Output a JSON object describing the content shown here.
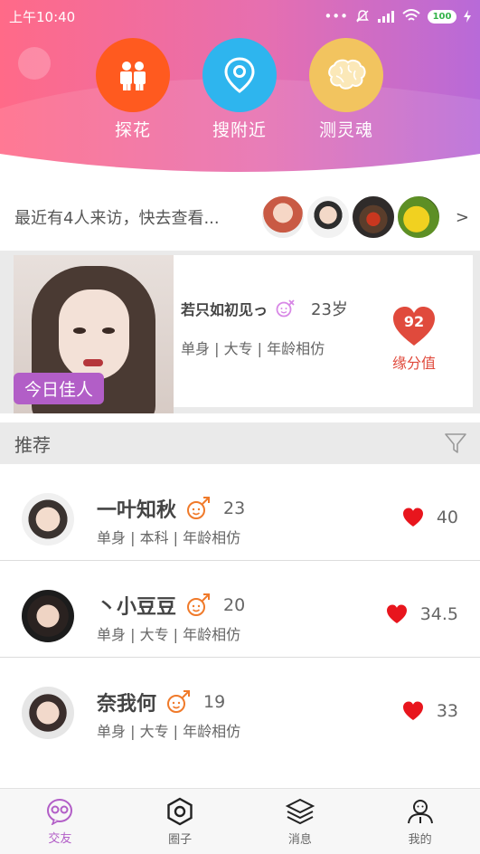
{
  "status_bar": {
    "time": "上午10:40",
    "dots": "•••",
    "battery": "100"
  },
  "features": [
    {
      "label": "探花",
      "icon": "people-icon",
      "color": "#ff5a1f"
    },
    {
      "label": "搜附近",
      "icon": "location-pin-icon",
      "color": "#2eb5ee"
    },
    {
      "label": "测灵魂",
      "icon": "brain-icon",
      "color": "#f2c45f"
    }
  ],
  "visitors": {
    "text": "最近有4人来访，快去查看...",
    "more": ">"
  },
  "today_pick": {
    "badge": "今日佳人",
    "name": "若只如初见っ",
    "age": "23岁",
    "tags": "单身 | 大专 | 年龄相仿",
    "score": "92",
    "score_label": "缘分值",
    "gender_icon": "female-gender-icon"
  },
  "recommend": {
    "title": "推荐",
    "filter_icon": "filter-icon"
  },
  "list": [
    {
      "name": "一叶知秋",
      "age": "23",
      "tags": "单身 | 本科 | 年龄相仿",
      "score": "40"
    },
    {
      "name": "丶小豆豆",
      "age": "20",
      "tags": "单身 | 大专 | 年龄相仿",
      "score": "34.5"
    },
    {
      "name": "奈我何",
      "age": "19",
      "tags": "单身 | 大专 | 年龄相仿",
      "score": "33"
    }
  ],
  "tabs": [
    {
      "label": "交友",
      "icon": "friends-icon",
      "active": true
    },
    {
      "label": "圈子",
      "icon": "hexagon-icon",
      "active": false
    },
    {
      "label": "消息",
      "icon": "layers-icon",
      "active": false
    },
    {
      "label": "我的",
      "icon": "profile-icon",
      "active": false
    }
  ],
  "colors": {
    "header_gradient_start": "#ff6a88",
    "header_gradient_end": "#b86ad8",
    "accent": "#b25ec7",
    "heart": "#e8151d",
    "gender_male": "#f07a2a",
    "gender_female": "#d888e6"
  }
}
